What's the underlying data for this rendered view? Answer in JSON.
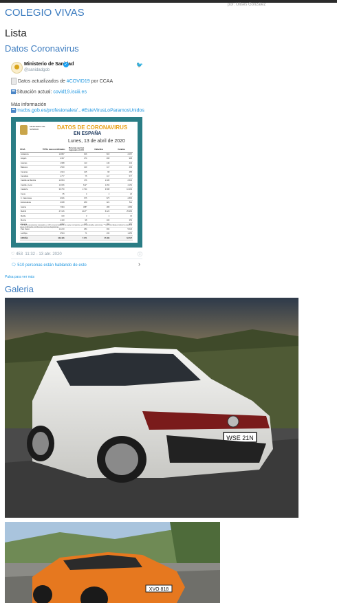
{
  "header": {
    "author": "por: Ulises González",
    "school_title": "COLEGIO VIVAS",
    "lista": "Lista"
  },
  "datos": {
    "heading": "Datos Coronavirus",
    "tweet": {
      "account_name": "Ministerio de Sanidad",
      "handle": "@sanidadgob",
      "line1_prefix": "Datos actualizados de ",
      "line1_hashtag": "#COVID19",
      "line1_suffix": " por CCAA",
      "line2_label": "Situación actual: ",
      "line2_link": "covid19.isciii.es",
      "line3": "Más información",
      "line4_link": "mscbs.gob.es/profesionales/...",
      "line4_hashtag": "#EsteVirusLoParamosUnidos",
      "likes": "453",
      "timestamp": "11:32 - 13 abr. 2020",
      "talking": "510 personas están hablando de esto",
      "image": {
        "ministry": "MINISTERIO DE SANIDAD",
        "title": "DATOS DE CORONAVIRUS",
        "subtitle": "EN ESPAÑA",
        "date": "Lunes, 13 de abril de 2020",
        "columns": [
          "CCAA",
          "TOTAL casos confirmados",
          "Personas que han ingresado en UCI",
          "Fallecidos",
          "Curados"
        ],
        "rows": [
          [
            "Andalucía",
            "10.887",
            "626",
            "815",
            "2.067"
          ],
          [
            "Aragón",
            "4.337",
            "274",
            "468",
            "998"
          ],
          [
            "Asturias",
            "1.988",
            "113",
            "149",
            "434"
          ],
          [
            "Baleares",
            "1.530",
            "140",
            "117",
            "493"
          ],
          [
            "Canarias",
            "1.944",
            "145",
            "98",
            "458"
          ],
          [
            "Cantabria",
            "1.777",
            "75",
            "117",
            "577"
          ],
          [
            "Castilla La Mancha",
            "13.654",
            "476",
            "1.635",
            "2.532"
          ],
          [
            "Castilla y León",
            "13.036",
            "612*",
            "1.453",
            "4.154"
          ],
          [
            "Cataluña",
            "36.750",
            "2.734",
            "3.838",
            "10.409"
          ],
          [
            "Ceuta",
            "95",
            "4",
            "4",
            "20"
          ],
          [
            "C. Valenciana",
            "9.666",
            "675",
            "875",
            "2.895"
          ],
          [
            "Extremadura",
            "3.038",
            "189",
            "321",
            "511"
          ],
          [
            "Galicia",
            "7.984",
            "398*",
            "288",
            "1.589"
          ],
          [
            "Madrid",
            "47.146",
            "2.127*",
            "6.423",
            "25.383"
          ],
          [
            "Melilla",
            "100",
            "3",
            "2",
            "32"
          ],
          [
            "Murcia",
            "1.410",
            "98",
            "100",
            "353"
          ],
          [
            "Navarra",
            "4.092",
            "125",
            "293",
            "965"
          ],
          [
            "País Vasco",
            "12.210",
            "484",
            "932",
            "5.023"
          ],
          [
            "La Rioja",
            "3.534",
            "71",
            "233",
            "1.456"
          ],
          [
            "ESPAÑA",
            "169.496",
            "7.371",
            "17.489",
            "64.727"
          ]
        ],
        "notes": "* Los datos de pacientes ingresados en UCI son acumulados y no pueden compararse entre comunidades autónomas. ** Las comunidades indican los datos de casos confirmados por diferentes técnicas diagnósticas."
      }
    },
    "pulsa": "Pulsa para ver más"
  },
  "galeria": {
    "heading": "Galeria",
    "photo1_plate": "WSE 21N",
    "photo2_plate": "XVO 818"
  }
}
